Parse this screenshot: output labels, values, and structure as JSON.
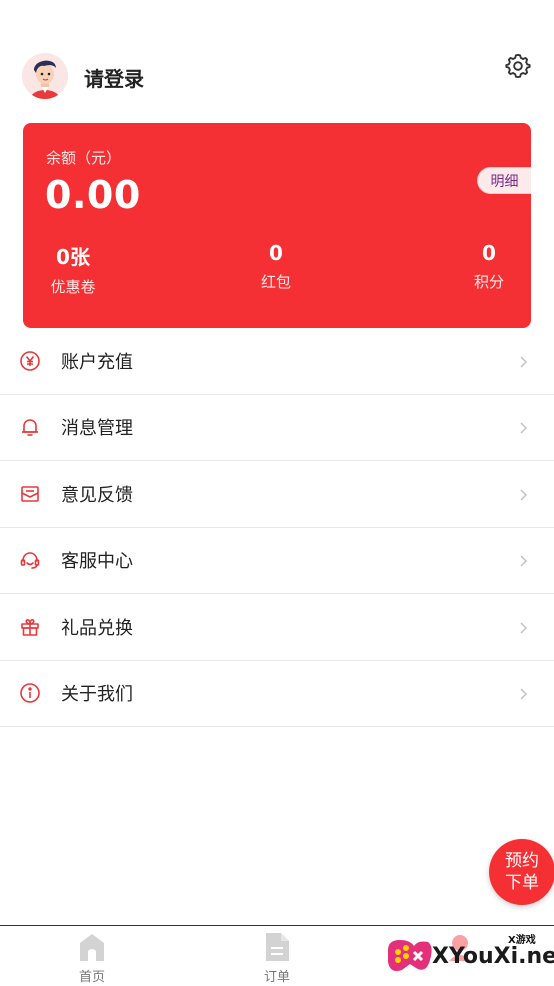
{
  "header": {
    "login_text": "请登录",
    "avatar_icon": "user-avatar",
    "settings_icon": "gear-icon"
  },
  "balance_card": {
    "label": "余额（元）",
    "value": "0.00",
    "detail_button": "明细",
    "background": "#f53034",
    "stats": [
      {
        "value": "0张",
        "label": "优惠卷"
      },
      {
        "value": "0",
        "label": "红包"
      },
      {
        "value": "0",
        "label": "积分"
      }
    ]
  },
  "menu": {
    "items": [
      {
        "label": "账户充值",
        "icon": "yuan-icon"
      },
      {
        "label": "消息管理",
        "icon": "bell-icon"
      },
      {
        "label": "意见反馈",
        "icon": "mail-icon"
      },
      {
        "label": "客服中心",
        "icon": "headset-icon"
      },
      {
        "label": "礼品兑换",
        "icon": "gift-icon"
      },
      {
        "label": "关于我们",
        "icon": "info-icon"
      }
    ]
  },
  "fab": {
    "line1": "预约",
    "line2": "下单"
  },
  "bottom_nav": {
    "items": [
      {
        "label": "首页",
        "icon": "home-icon"
      },
      {
        "label": "订单",
        "icon": "document-icon"
      },
      {
        "label": "",
        "icon": "user-icon"
      }
    ]
  },
  "watermark": {
    "text": "XYouXi.net",
    "small": "X游戏"
  },
  "colors": {
    "accent": "#f53034",
    "divider": "#e8e8e8"
  }
}
